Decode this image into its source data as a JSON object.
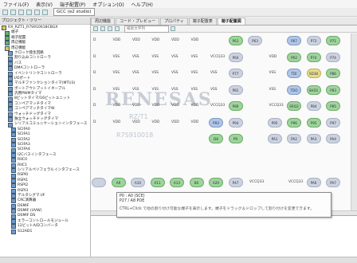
{
  "menu": [
    "ファイル(F)",
    "表示(V)",
    "端子配置(P)",
    "オプション(O)",
    "ヘルプ(H)"
  ],
  "toolbar": {
    "combo": "GCC (e2 studio)"
  },
  "left_panel": {
    "title": "プロジェクト・ツリー",
    "tree": [
      {
        "label": "RX_RZT1_R7S910018CBGX",
        "icon": "folder-icon"
      },
      {
        "label": "端子",
        "icon": "pin-icon"
      },
      {
        "label": "端子配置",
        "icon": "pin-icon"
      },
      {
        "label": "周辺機能",
        "icon": "pin-icon"
      },
      {
        "label": "周辺機能",
        "icon": "folder-icon"
      },
      {
        "label": "クロック発生回路",
        "icon": "module-icon"
      },
      {
        "label": "割り込みコントローラ",
        "icon": "module-icon"
      },
      {
        "label": "バス",
        "icon": "module-icon"
      },
      {
        "label": "DMAコントローラ",
        "icon": "module-icon"
      },
      {
        "label": "イベントリンクコントローラ",
        "icon": "module-icon"
      },
      {
        "label": "I/Oポート",
        "icon": "module-icon"
      },
      {
        "label": "マルチファンクションタイマ(MTU3)",
        "icon": "module-icon"
      },
      {
        "label": "ポートアウトプットイネーブル",
        "icon": "module-icon"
      },
      {
        "label": "汎用PWMタイマ",
        "icon": "module-icon"
      },
      {
        "label": "8ビットタイマ/16ビットユニット",
        "icon": "module-icon"
      },
      {
        "label": "コンペアマッチタイマ",
        "icon": "module-icon"
      },
      {
        "label": "コンペアマッチタイマW",
        "icon": "module-icon"
      },
      {
        "label": "ウォッチドッグタイマ",
        "icon": "module-icon"
      },
      {
        "label": "独立ウォッチドッグタイマ",
        "icon": "module-icon"
      },
      {
        "label": "シリアルコミュニケーションインタフェース",
        "icon": "module-icon"
      },
      {
        "label": "SCIFA0",
        "icon": "module-icon"
      },
      {
        "label": "SCIFA1",
        "icon": "module-icon"
      },
      {
        "label": "SCIFA2",
        "icon": "module-icon"
      },
      {
        "label": "SCIFA3",
        "icon": "module-icon"
      },
      {
        "label": "SCIFA4",
        "icon": "module-icon"
      },
      {
        "label": "I2Cバスインタフェース",
        "icon": "module-icon"
      },
      {
        "label": "RIIC0",
        "icon": "module-icon"
      },
      {
        "label": "RIIC1",
        "icon": "module-icon"
      },
      {
        "label": "シリアルペリフェラルインタフェース",
        "icon": "module-icon"
      },
      {
        "label": "RSPI0",
        "icon": "module-icon"
      },
      {
        "label": "RSPI1",
        "icon": "module-icon"
      },
      {
        "label": "RSPI2",
        "icon": "module-icon"
      },
      {
        "label": "RSPI3",
        "icon": "module-icon"
      },
      {
        "label": "デルタシグマ I/F",
        "icon": "module-icon"
      },
      {
        "label": "CRC演算器",
        "icon": "module-icon"
      },
      {
        "label": "DSMIF",
        "icon": "module-icon"
      },
      {
        "label": "DSMIF (UVW)",
        "icon": "module-icon"
      },
      {
        "label": "DSMIF DS",
        "icon": "module-icon"
      },
      {
        "label": "エラーコントロールモジュール",
        "icon": "module-icon"
      },
      {
        "label": "12ビットA/Dコンバータ",
        "icon": "module-icon"
      },
      {
        "label": "S12AD1",
        "icon": "module-icon"
      }
    ]
  },
  "tabs": [
    {
      "label": "周辺機能",
      "active": false
    },
    {
      "label": "コード・プレビュー",
      "active": false
    },
    {
      "label": "プロパティ",
      "active": false
    },
    {
      "label": "端子配置表",
      "active": false
    },
    {
      "label": "端子配置図",
      "active": true
    }
  ],
  "subtool": {
    "search_placeholder": "検索文字列"
  },
  "canvas": {
    "logo": "RENESAS",
    "chip_line1": "RZ/T1",
    "chip_line2": "R7S910018",
    "rows": [
      {
        "cells": [
          {
            "t": "D",
            "k": "plain"
          },
          {
            "t": "VDD",
            "k": "plain"
          },
          {
            "t": "VDD",
            "k": "plain"
          },
          {
            "t": "VDD",
            "k": "plain"
          },
          {
            "t": "VDD",
            "k": "plain"
          },
          {
            "t": "VDD",
            "k": "plain"
          },
          {
            "t": "",
            "k": "none"
          },
          {
            "t": "P61",
            "k": "green"
          },
          {
            "t": "P63",
            "k": "gray"
          },
          {
            "t": "",
            "k": "none"
          },
          {
            "t": "P67",
            "k": "blue"
          },
          {
            "t": "P73",
            "k": "gray"
          },
          {
            "t": "P71",
            "k": "green"
          }
        ]
      },
      {
        "cells": [
          {
            "t": "D",
            "k": "plain"
          },
          {
            "t": "VSS",
            "k": "plain"
          },
          {
            "t": "VSS",
            "k": "plain"
          },
          {
            "t": "VSS",
            "k": "plain"
          },
          {
            "t": "VSS",
            "k": "plain"
          },
          {
            "t": "VSS",
            "k": "plain"
          },
          {
            "t": "VCCQ33",
            "k": "plain"
          },
          {
            "t": "P64",
            "k": "gray"
          },
          {
            "t": "",
            "k": "none"
          },
          {
            "t": "VDD",
            "k": "plain"
          },
          {
            "t": "PR2",
            "k": "green"
          },
          {
            "t": "P74",
            "k": "green"
          },
          {
            "t": "P74",
            "k": "gray"
          }
        ]
      },
      {
        "cells": [
          {
            "t": "D",
            "k": "plain"
          },
          {
            "t": "VSS",
            "k": "plain"
          },
          {
            "t": "VSS",
            "k": "plain"
          },
          {
            "t": "VSS",
            "k": "plain"
          },
          {
            "t": "VSS",
            "k": "plain"
          },
          {
            "t": "VSS",
            "k": "plain"
          },
          {
            "t": "VSS",
            "k": "plain"
          },
          {
            "t": "P77",
            "k": "gray"
          },
          {
            "t": "",
            "k": "none"
          },
          {
            "t": "VSS",
            "k": "plain"
          },
          {
            "t": "TDI",
            "k": "blue"
          },
          {
            "t": "SD38",
            "k": "yellow"
          },
          {
            "t": "P86",
            "k": "green"
          }
        ]
      },
      {
        "cells": [
          {
            "t": "D",
            "k": "plain"
          },
          {
            "t": "VSS",
            "k": "plain"
          },
          {
            "t": "VSS",
            "k": "plain"
          },
          {
            "t": "VSS",
            "k": "plain"
          },
          {
            "t": "VSS",
            "k": "plain"
          },
          {
            "t": "VSS",
            "k": "plain"
          },
          {
            "t": "VSS",
            "k": "plain"
          },
          {
            "t": "P81",
            "k": "gray"
          },
          {
            "t": "",
            "k": "none"
          },
          {
            "t": "VSS",
            "k": "plain"
          },
          {
            "t": "TDO",
            "k": "blue"
          },
          {
            "t": "SHD1",
            "k": "green"
          },
          {
            "t": "P83",
            "k": "green"
          }
        ]
      },
      {
        "cells": [
          {
            "t": "D",
            "k": "plain"
          },
          {
            "t": "VDD",
            "k": "plain"
          },
          {
            "t": "VDD",
            "k": "plain"
          },
          {
            "t": "VDD",
            "k": "plain"
          },
          {
            "t": "VDD",
            "k": "plain"
          },
          {
            "t": "VDD",
            "k": "plain"
          },
          {
            "t": "VCCQ33",
            "k": "plain"
          },
          {
            "t": "P86",
            "k": "green"
          },
          {
            "t": "",
            "k": "none"
          },
          {
            "t": "VCCQ33",
            "k": "plain"
          },
          {
            "t": "SRQ2",
            "k": "green"
          },
          {
            "t": "P84",
            "k": "gray"
          },
          {
            "t": "P85",
            "k": "green"
          }
        ]
      },
      {
        "cells": [
          {
            "t": "D",
            "k": "plain"
          },
          {
            "t": "VDD",
            "k": "plain"
          },
          {
            "t": "VDD",
            "k": "plain"
          },
          {
            "t": "VDD",
            "k": "plain"
          },
          {
            "t": "VDD",
            "k": "plain"
          },
          {
            "t": "VDD",
            "k": "plain"
          },
          {
            "t": "P93",
            "k": "blue"
          },
          {
            "t": "P94",
            "k": "gray"
          },
          {
            "t": "",
            "k": "none"
          },
          {
            "t": "P95",
            "k": "gray"
          },
          {
            "t": "P96",
            "k": "green"
          },
          {
            "t": "P95",
            "k": "green"
          },
          {
            "t": "P97",
            "k": "gray"
          }
        ]
      },
      {
        "cells": [
          {
            "t": "",
            "k": "none"
          },
          {
            "t": "",
            "k": "none"
          },
          {
            "t": "",
            "k": "none"
          },
          {
            "t": "",
            "k": "none"
          },
          {
            "t": "",
            "k": "none"
          },
          {
            "t": "",
            "k": "none"
          },
          {
            "t": "D8",
            "k": "green"
          },
          {
            "t": "P9",
            "k": "green"
          },
          {
            "t": "",
            "k": "none"
          },
          {
            "t": "PA1",
            "k": "gray"
          },
          {
            "t": "PA2",
            "k": "gray"
          },
          {
            "t": "PA3",
            "k": "gray"
          },
          {
            "t": "PA4",
            "k": "gray"
          }
        ]
      },
      {
        "cells": [
          {
            "t": "",
            "k": "gray"
          },
          {
            "t": "A9",
            "k": "green"
          },
          {
            "t": "A10",
            "k": "gray"
          },
          {
            "t": "A11",
            "k": "green"
          },
          {
            "t": "A13",
            "k": "green"
          },
          {
            "t": "B0",
            "k": "green"
          },
          {
            "t": "A20",
            "k": "green"
          },
          {
            "t": "P47",
            "k": "gray"
          },
          {
            "t": "VCCQ33",
            "k": "plain"
          },
          {
            "t": "",
            "k": "none"
          },
          {
            "t": "VCCQ33",
            "k": "plain"
          },
          {
            "t": "PA6",
            "k": "gray"
          },
          {
            "t": "PA7",
            "k": "gray"
          }
        ]
      }
    ]
  },
  "tooltip": {
    "line1": "P0 : A0 (SCE)",
    "line2": "P27 / A8 POE",
    "line3": "CTRL+Click で他の割り付け可能な端子を表示します。端子をドラッグ＆ドロップして割り付けを変更できます。"
  },
  "colors": {
    "green": "#9fd39c",
    "blue": "#b0c6e6",
    "gray": "#ccd2df",
    "yellow": "#e6dc8a"
  }
}
